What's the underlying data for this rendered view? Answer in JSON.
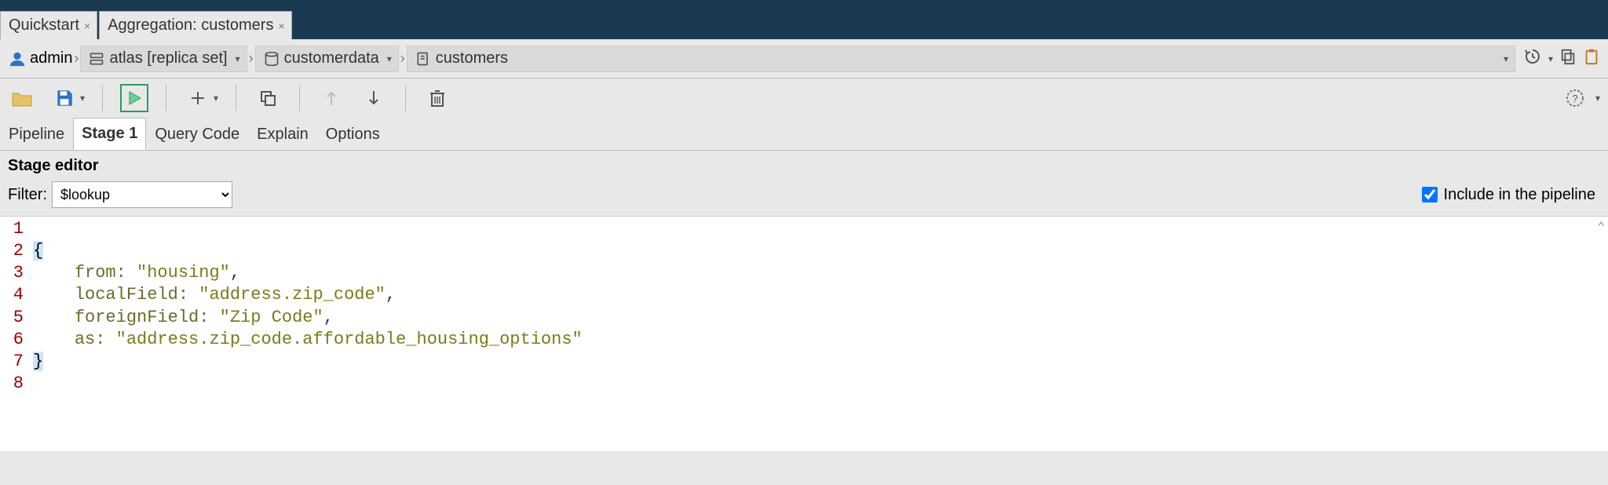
{
  "tabs": [
    {
      "label": "Quickstart"
    },
    {
      "label": "Aggregation: customers"
    }
  ],
  "breadcrumb": {
    "user": "admin",
    "server": "atlas [replica set]",
    "database": "customerdata",
    "collection": "customers"
  },
  "subtabs": {
    "pipeline": "Pipeline",
    "stage1": "Stage 1",
    "querycode": "Query Code",
    "explain": "Explain",
    "options": "Options"
  },
  "stage_editor": {
    "title": "Stage editor",
    "filter_label": "Filter:",
    "filter_value": "$lookup",
    "include_label": "Include in the pipeline",
    "include_checked": true
  },
  "code": {
    "lines": [
      "1",
      "2",
      "3",
      "4",
      "5",
      "6",
      "7",
      "8"
    ],
    "l1_open": "{",
    "l2_key": "from:",
    "l2_val": "\"housing\"",
    "l2_end": ",",
    "l3_key": "localField:",
    "l3_val": "\"address.zip_code\"",
    "l3_end": ",",
    "l4_key": "foreignField:",
    "l4_val": "\"Zip Code\"",
    "l4_end": ",",
    "l5_key": "as:",
    "l5_val": "\"address.zip_code.affordable_housing_options\"",
    "l6_close": "}"
  }
}
